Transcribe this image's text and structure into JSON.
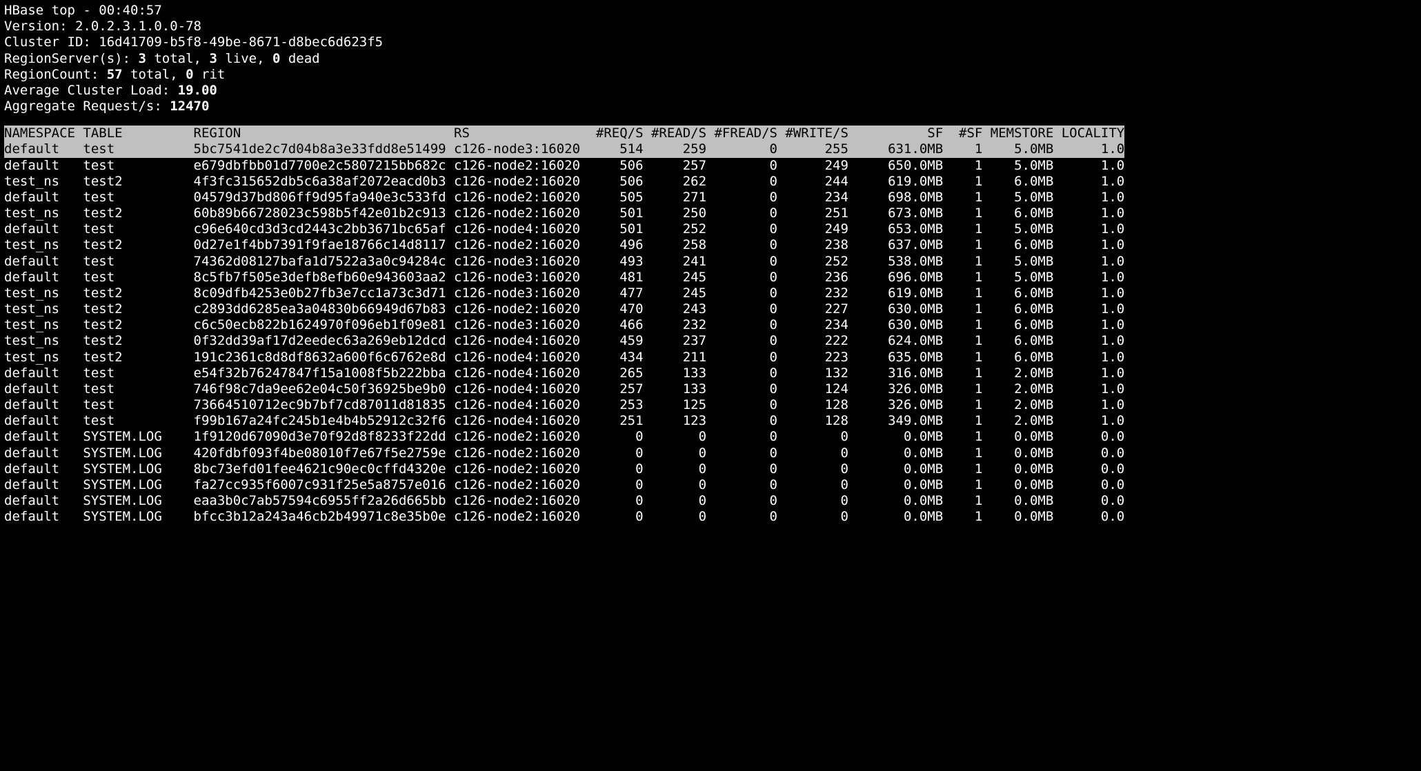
{
  "header": {
    "title_prefix": "HBase top - ",
    "time": "00:40:57",
    "version_label": "Version: ",
    "version_value": "2.0.2.3.1.0.0-78",
    "cluster_label": "Cluster ID: ",
    "cluster_value": "16d41709-b5f8-49be-8671-d8bec6d623f5",
    "rs_label": "RegionServer(s): ",
    "rs_total": "3",
    "rs_total_suffix": " total, ",
    "rs_live": "3",
    "rs_live_suffix": " live, ",
    "rs_dead": "0",
    "rs_dead_suffix": " dead",
    "rc_label": "RegionCount: ",
    "rc_total": "57",
    "rc_total_suffix": " total, ",
    "rc_rit": "0",
    "rc_rit_suffix": " rit",
    "acl_label": "Average Cluster Load: ",
    "acl_value": "19.00",
    "agg_label": "Aggregate Request/s: ",
    "agg_value": "12470"
  },
  "columns": {
    "ns": "NAMESPACE",
    "table": "TABLE",
    "region": "REGION",
    "rs": "RS",
    "req": "#REQ/S",
    "read": "#READ/S",
    "fread": "#FREAD/S",
    "write": "#WRITE/S",
    "sf": "SF",
    "nsf": "#SF",
    "mem": "MEMSTORE",
    "loc": "LOCALITY"
  },
  "rows": [
    {
      "ns": "default",
      "table": "test",
      "region": "5bc7541de2c7d04b8a3e33fdd8e51499",
      "rs": "c126-node3:16020",
      "req": "514",
      "read": "259",
      "fread": "0",
      "write": "255",
      "sf": "631.0MB",
      "nsf": "1",
      "mem": "5.0MB",
      "loc": "1.0",
      "selected": true
    },
    {
      "ns": "default",
      "table": "test",
      "region": "e679dbfbb01d7700e2c5807215bb682c",
      "rs": "c126-node2:16020",
      "req": "506",
      "read": "257",
      "fread": "0",
      "write": "249",
      "sf": "650.0MB",
      "nsf": "1",
      "mem": "5.0MB",
      "loc": "1.0"
    },
    {
      "ns": "test_ns",
      "table": "test2",
      "region": "4f3fc315652db5c6a38af2072eacd0b3",
      "rs": "c126-node2:16020",
      "req": "506",
      "read": "262",
      "fread": "0",
      "write": "244",
      "sf": "619.0MB",
      "nsf": "1",
      "mem": "6.0MB",
      "loc": "1.0"
    },
    {
      "ns": "default",
      "table": "test",
      "region": "04579d37bd806ff9d95fa940e3c533fd",
      "rs": "c126-node2:16020",
      "req": "505",
      "read": "271",
      "fread": "0",
      "write": "234",
      "sf": "698.0MB",
      "nsf": "1",
      "mem": "5.0MB",
      "loc": "1.0"
    },
    {
      "ns": "test_ns",
      "table": "test2",
      "region": "60b89b66728023c598b5f42e01b2c913",
      "rs": "c126-node2:16020",
      "req": "501",
      "read": "250",
      "fread": "0",
      "write": "251",
      "sf": "673.0MB",
      "nsf": "1",
      "mem": "6.0MB",
      "loc": "1.0"
    },
    {
      "ns": "default",
      "table": "test",
      "region": "c96e640cd3d3cd2443c2bb3671bc65af",
      "rs": "c126-node4:16020",
      "req": "501",
      "read": "252",
      "fread": "0",
      "write": "249",
      "sf": "653.0MB",
      "nsf": "1",
      "mem": "5.0MB",
      "loc": "1.0"
    },
    {
      "ns": "test_ns",
      "table": "test2",
      "region": "0d27e1f4bb7391f9fae18766c14d8117",
      "rs": "c126-node2:16020",
      "req": "496",
      "read": "258",
      "fread": "0",
      "write": "238",
      "sf": "637.0MB",
      "nsf": "1",
      "mem": "6.0MB",
      "loc": "1.0"
    },
    {
      "ns": "default",
      "table": "test",
      "region": "74362d08127bafa1d7522a3a0c94284c",
      "rs": "c126-node3:16020",
      "req": "493",
      "read": "241",
      "fread": "0",
      "write": "252",
      "sf": "538.0MB",
      "nsf": "1",
      "mem": "5.0MB",
      "loc": "1.0"
    },
    {
      "ns": "default",
      "table": "test",
      "region": "8c5fb7f505e3defb8efb60e943603aa2",
      "rs": "c126-node3:16020",
      "req": "481",
      "read": "245",
      "fread": "0",
      "write": "236",
      "sf": "696.0MB",
      "nsf": "1",
      "mem": "5.0MB",
      "loc": "1.0"
    },
    {
      "ns": "test_ns",
      "table": "test2",
      "region": "8c09dfb4253e0b27fb3e7cc1a73c3d71",
      "rs": "c126-node3:16020",
      "req": "477",
      "read": "245",
      "fread": "0",
      "write": "232",
      "sf": "619.0MB",
      "nsf": "1",
      "mem": "6.0MB",
      "loc": "1.0"
    },
    {
      "ns": "test_ns",
      "table": "test2",
      "region": "c2893dd6285ea3a04830b66949d67b83",
      "rs": "c126-node2:16020",
      "req": "470",
      "read": "243",
      "fread": "0",
      "write": "227",
      "sf": "630.0MB",
      "nsf": "1",
      "mem": "6.0MB",
      "loc": "1.0"
    },
    {
      "ns": "test_ns",
      "table": "test2",
      "region": "c6c50ecb822b1624970f096eb1f09e81",
      "rs": "c126-node3:16020",
      "req": "466",
      "read": "232",
      "fread": "0",
      "write": "234",
      "sf": "630.0MB",
      "nsf": "1",
      "mem": "6.0MB",
      "loc": "1.0"
    },
    {
      "ns": "test_ns",
      "table": "test2",
      "region": "0f32dd39af17d2eedec63a269eb12dcd",
      "rs": "c126-node4:16020",
      "req": "459",
      "read": "237",
      "fread": "0",
      "write": "222",
      "sf": "624.0MB",
      "nsf": "1",
      "mem": "6.0MB",
      "loc": "1.0"
    },
    {
      "ns": "test_ns",
      "table": "test2",
      "region": "191c2361c8d8df8632a600f6c6762e8d",
      "rs": "c126-node4:16020",
      "req": "434",
      "read": "211",
      "fread": "0",
      "write": "223",
      "sf": "635.0MB",
      "nsf": "1",
      "mem": "6.0MB",
      "loc": "1.0"
    },
    {
      "ns": "default",
      "table": "test",
      "region": "e54f32b76247847f15a1008f5b222bba",
      "rs": "c126-node4:16020",
      "req": "265",
      "read": "133",
      "fread": "0",
      "write": "132",
      "sf": "316.0MB",
      "nsf": "1",
      "mem": "2.0MB",
      "loc": "1.0"
    },
    {
      "ns": "default",
      "table": "test",
      "region": "746f98c7da9ee62e04c50f36925be9b0",
      "rs": "c126-node4:16020",
      "req": "257",
      "read": "133",
      "fread": "0",
      "write": "124",
      "sf": "326.0MB",
      "nsf": "1",
      "mem": "2.0MB",
      "loc": "1.0"
    },
    {
      "ns": "default",
      "table": "test",
      "region": "73664510712ec9b7bf7cd87011d81835",
      "rs": "c126-node4:16020",
      "req": "253",
      "read": "125",
      "fread": "0",
      "write": "128",
      "sf": "326.0MB",
      "nsf": "1",
      "mem": "2.0MB",
      "loc": "1.0"
    },
    {
      "ns": "default",
      "table": "test",
      "region": "f99b167a24fc245b1e4b4b52912c32f6",
      "rs": "c126-node4:16020",
      "req": "251",
      "read": "123",
      "fread": "0",
      "write": "128",
      "sf": "349.0MB",
      "nsf": "1",
      "mem": "2.0MB",
      "loc": "1.0"
    },
    {
      "ns": "default",
      "table": "SYSTEM.LOG",
      "region": "1f9120d67090d3e70f92d8f8233f22dd",
      "rs": "c126-node2:16020",
      "req": "0",
      "read": "0",
      "fread": "0",
      "write": "0",
      "sf": "0.0MB",
      "nsf": "1",
      "mem": "0.0MB",
      "loc": "0.0"
    },
    {
      "ns": "default",
      "table": "SYSTEM.LOG",
      "region": "420fdbf093f4be08010f7e67f5e2759e",
      "rs": "c126-node2:16020",
      "req": "0",
      "read": "0",
      "fread": "0",
      "write": "0",
      "sf": "0.0MB",
      "nsf": "1",
      "mem": "0.0MB",
      "loc": "0.0"
    },
    {
      "ns": "default",
      "table": "SYSTEM.LOG",
      "region": "8bc73efd01fee4621c90ec0cffd4320e",
      "rs": "c126-node2:16020",
      "req": "0",
      "read": "0",
      "fread": "0",
      "write": "0",
      "sf": "0.0MB",
      "nsf": "1",
      "mem": "0.0MB",
      "loc": "0.0"
    },
    {
      "ns": "default",
      "table": "SYSTEM.LOG",
      "region": "fa27cc935f6007c931f25e5a8757e016",
      "rs": "c126-node2:16020",
      "req": "0",
      "read": "0",
      "fread": "0",
      "write": "0",
      "sf": "0.0MB",
      "nsf": "1",
      "mem": "0.0MB",
      "loc": "0.0"
    },
    {
      "ns": "default",
      "table": "SYSTEM.LOG",
      "region": "eaa3b0c7ab57594c6955ff2a26d665bb",
      "rs": "c126-node2:16020",
      "req": "0",
      "read": "0",
      "fread": "0",
      "write": "0",
      "sf": "0.0MB",
      "nsf": "1",
      "mem": "0.0MB",
      "loc": "0.0"
    },
    {
      "ns": "default",
      "table": "SYSTEM.LOG",
      "region": "bfcc3b12a243a46cb2b49971c8e35b0e",
      "rs": "c126-node2:16020",
      "req": "0",
      "read": "0",
      "fread": "0",
      "write": "0",
      "sf": "0.0MB",
      "nsf": "1",
      "mem": "0.0MB",
      "loc": "0.0"
    }
  ]
}
